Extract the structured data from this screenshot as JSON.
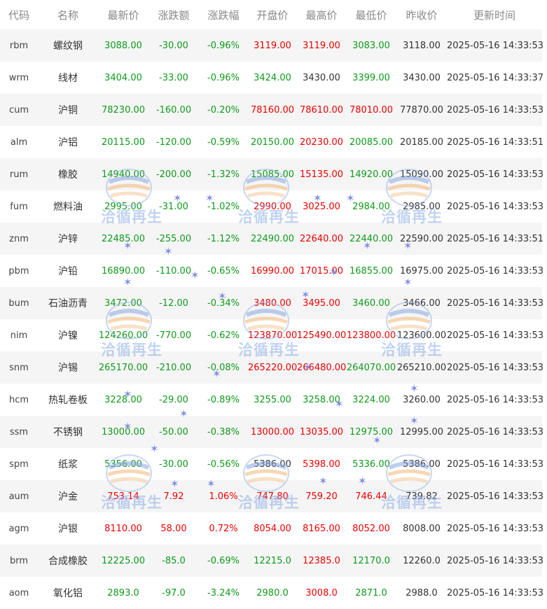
{
  "headers": [
    "代码",
    "名称",
    "最新价",
    "涨跌额",
    "涨跌幅",
    "开盘价",
    "最高价",
    "最低价",
    "昨收价",
    "更新时间"
  ],
  "rows": [
    {
      "code": "rbm",
      "name": "螺纹钢",
      "latest": "3088.00",
      "change": "-30.00",
      "pct": "-0.96%",
      "open": "3119.00",
      "high": "3119.00",
      "low": "3083.00",
      "prev": "3118.00",
      "time": "2025-05-16 14:33:53",
      "c": [
        "down",
        "down",
        "down",
        "up",
        "up",
        "down",
        "flat"
      ]
    },
    {
      "code": "wrm",
      "name": "线材",
      "latest": "3404.00",
      "change": "-33.00",
      "pct": "-0.96%",
      "open": "3424.00",
      "high": "3430.00",
      "low": "3399.00",
      "prev": "3430.00",
      "time": "2025-05-16 14:33:37",
      "c": [
        "down",
        "down",
        "down",
        "down",
        "flat",
        "down",
        "flat"
      ]
    },
    {
      "code": "cum",
      "name": "沪铜",
      "latest": "78230.00",
      "change": "-160.00",
      "pct": "-0.20%",
      "open": "78160.00",
      "high": "78610.00",
      "low": "78010.00",
      "prev": "77870.00",
      "time": "2025-05-16 14:33:53",
      "c": [
        "down",
        "down",
        "down",
        "up",
        "up",
        "up",
        "flat"
      ]
    },
    {
      "code": "alm",
      "name": "沪铝",
      "latest": "20115.00",
      "change": "-120.00",
      "pct": "-0.59%",
      "open": "20150.00",
      "high": "20230.00",
      "low": "20085.00",
      "prev": "20185.00",
      "time": "2025-05-16 14:33:51",
      "c": [
        "down",
        "down",
        "down",
        "down",
        "up",
        "down",
        "flat"
      ]
    },
    {
      "code": "rum",
      "name": "橡胶",
      "latest": "14940.00",
      "change": "-200.00",
      "pct": "-1.32%",
      "open": "15085.00",
      "high": "15135.00",
      "low": "14920.00",
      "prev": "15090.00",
      "time": "2025-05-16 14:33:53",
      "c": [
        "down",
        "down",
        "down",
        "down",
        "up",
        "down",
        "flat"
      ]
    },
    {
      "code": "fum",
      "name": "燃料油",
      "latest": "2995.00",
      "change": "-31.00",
      "pct": "-1.02%",
      "open": "2990.00",
      "high": "3025.00",
      "low": "2984.00",
      "prev": "2985.00",
      "time": "2025-05-16 14:33:53",
      "c": [
        "down",
        "down",
        "down",
        "up",
        "up",
        "down",
        "flat"
      ]
    },
    {
      "code": "znm",
      "name": "沪锌",
      "latest": "22485.00",
      "change": "-255.00",
      "pct": "-1.12%",
      "open": "22490.00",
      "high": "22640.00",
      "low": "22440.00",
      "prev": "22590.00",
      "time": "2025-05-16 14:33:51",
      "c": [
        "down",
        "down",
        "down",
        "down",
        "up",
        "down",
        "flat"
      ]
    },
    {
      "code": "pbm",
      "name": "沪铅",
      "latest": "16890.00",
      "change": "-110.00",
      "pct": "-0.65%",
      "open": "16990.00",
      "high": "17015.00",
      "low": "16855.00",
      "prev": "16975.00",
      "time": "2025-05-16 14:33:53",
      "c": [
        "down",
        "down",
        "down",
        "up",
        "up",
        "down",
        "flat"
      ]
    },
    {
      "code": "bum",
      "name": "石油沥青",
      "latest": "3472.00",
      "change": "-12.00",
      "pct": "-0.34%",
      "open": "3480.00",
      "high": "3495.00",
      "low": "3460.00",
      "prev": "3466.00",
      "time": "2025-05-16 14:33:53",
      "c": [
        "down",
        "down",
        "down",
        "up",
        "up",
        "down",
        "flat"
      ]
    },
    {
      "code": "nim",
      "name": "沪镍",
      "latest": "124260.00",
      "change": "-770.00",
      "pct": "-0.62%",
      "open": "123870.00",
      "high": "125490.00",
      "low": "123800.00",
      "prev": "123600.00",
      "time": "2025-05-16 14:33:53",
      "c": [
        "down",
        "down",
        "down",
        "up",
        "up",
        "up",
        "flat"
      ]
    },
    {
      "code": "snm",
      "name": "沪锡",
      "latest": "265170.00",
      "change": "-210.00",
      "pct": "-0.08%",
      "open": "265220.00",
      "high": "266480.00",
      "low": "264070.00",
      "prev": "265210.00",
      "time": "2025-05-16 14:33:53",
      "c": [
        "down",
        "down",
        "down",
        "up",
        "up",
        "down",
        "flat"
      ]
    },
    {
      "code": "hcm",
      "name": "热轧卷板",
      "latest": "3228.00",
      "change": "-29.00",
      "pct": "-0.89%",
      "open": "3255.00",
      "high": "3258.00",
      "low": "3224.00",
      "prev": "3260.00",
      "time": "2025-05-16 14:33:53",
      "c": [
        "down",
        "down",
        "down",
        "down",
        "down",
        "down",
        "flat"
      ]
    },
    {
      "code": "ssm",
      "name": "不锈钢",
      "latest": "13000.00",
      "change": "-50.00",
      "pct": "-0.38%",
      "open": "13000.00",
      "high": "13035.00",
      "low": "12975.00",
      "prev": "12995.00",
      "time": "2025-05-16 14:33:53",
      "c": [
        "down",
        "down",
        "down",
        "up",
        "up",
        "down",
        "flat"
      ]
    },
    {
      "code": "spm",
      "name": "纸浆",
      "latest": "5356.00",
      "change": "-30.00",
      "pct": "-0.56%",
      "open": "5386.00",
      "high": "5398.00",
      "low": "5336.00",
      "prev": "5386.00",
      "time": "2025-05-16 14:33:53",
      "c": [
        "down",
        "down",
        "down",
        "flat",
        "up",
        "down",
        "flat"
      ]
    },
    {
      "code": "aum",
      "name": "沪金",
      "latest": "753.14",
      "change": "7.92",
      "pct": "1.06%",
      "open": "747.80",
      "high": "759.20",
      "low": "746.44",
      "prev": "739.82",
      "time": "2025-05-16 14:33:53",
      "c": [
        "up",
        "up",
        "up",
        "up",
        "up",
        "up",
        "flat"
      ]
    },
    {
      "code": "agm",
      "name": "沪银",
      "latest": "8110.00",
      "change": "58.00",
      "pct": "0.72%",
      "open": "8054.00",
      "high": "8165.00",
      "low": "8052.00",
      "prev": "8008.00",
      "time": "2025-05-16 14:33:53",
      "c": [
        "up",
        "up",
        "up",
        "up",
        "up",
        "up",
        "flat"
      ]
    },
    {
      "code": "brm",
      "name": "合成橡胶",
      "latest": "12225.00",
      "change": "-85.0",
      "pct": "-0.69%",
      "open": "12215.0",
      "high": "12385.0",
      "low": "12170.0",
      "prev": "12260.0",
      "time": "2025-05-16 14:33:53",
      "c": [
        "down",
        "down",
        "down",
        "down",
        "up",
        "down",
        "flat"
      ]
    },
    {
      "code": "aom",
      "name": "氧化铝",
      "latest": "2893.0",
      "change": "-97.0",
      "pct": "-3.24%",
      "open": "2980.0",
      "high": "3008.0",
      "low": "2871.0",
      "prev": "2988.0",
      "time": "2025-05-16 14:33:53",
      "c": [
        "down",
        "down",
        "down",
        "down",
        "up",
        "down",
        "flat"
      ]
    }
  ],
  "watermark_text": "洽循再生",
  "colors": {
    "up": "#ee0000",
    "down": "#0f9a1b",
    "flat": "#333333",
    "header": "#888888",
    "stripe": "#f5f5f5"
  }
}
